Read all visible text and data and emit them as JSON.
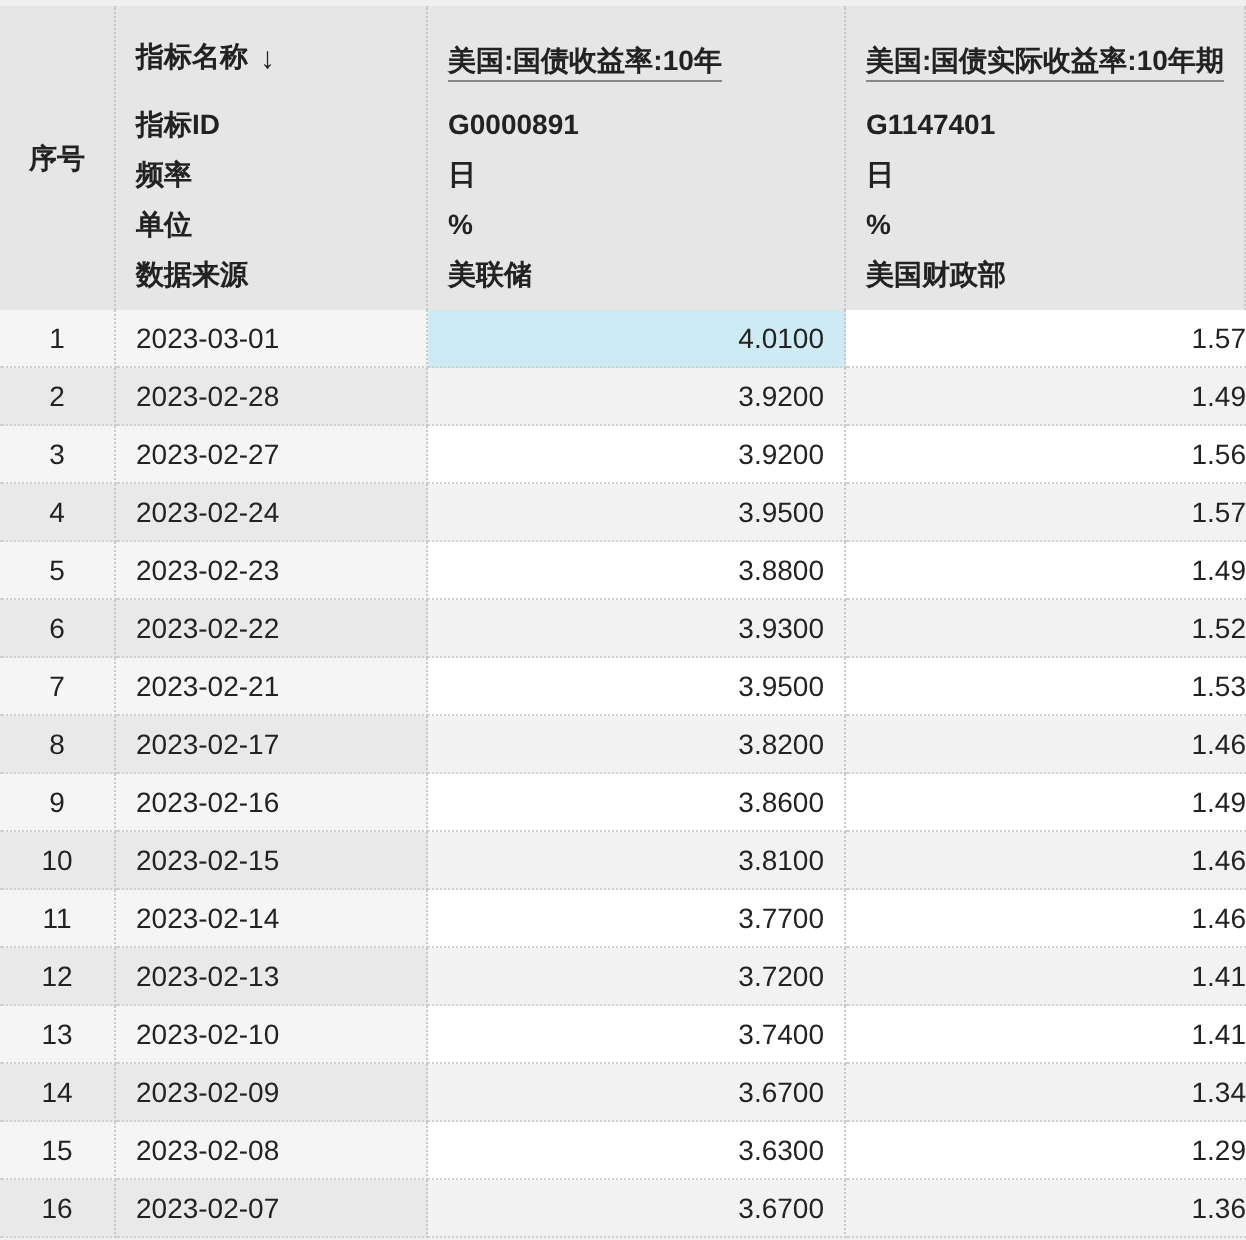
{
  "header": {
    "index_label": "序号",
    "name_label": "指标名称",
    "sort_mark": "↓",
    "field_labels": [
      "指标ID",
      "频率",
      "单位",
      "数据来源"
    ],
    "series": [
      {
        "name": "美国:国债收益率:10年",
        "fields": [
          "G0000891",
          "日",
          "%",
          "美联储"
        ]
      },
      {
        "name": "美国:国债实际收益率:10年期",
        "fields": [
          "G1147401",
          "日",
          "%",
          "美国财政部"
        ]
      }
    ]
  },
  "rows": [
    {
      "index": "1",
      "date": "2023-03-01",
      "values": [
        {
          "text": "4.0100",
          "selected": true
        },
        {
          "text": "1.57",
          "selected": false
        }
      ]
    },
    {
      "index": "2",
      "date": "2023-02-28",
      "values": [
        {
          "text": "3.9200",
          "selected": false
        },
        {
          "text": "1.49",
          "selected": false
        }
      ]
    },
    {
      "index": "3",
      "date": "2023-02-27",
      "values": [
        {
          "text": "3.9200",
          "selected": false
        },
        {
          "text": "1.56",
          "selected": false
        }
      ]
    },
    {
      "index": "4",
      "date": "2023-02-24",
      "values": [
        {
          "text": "3.9500",
          "selected": false
        },
        {
          "text": "1.57",
          "selected": false
        }
      ]
    },
    {
      "index": "5",
      "date": "2023-02-23",
      "values": [
        {
          "text": "3.8800",
          "selected": false
        },
        {
          "text": "1.49",
          "selected": false
        }
      ]
    },
    {
      "index": "6",
      "date": "2023-02-22",
      "values": [
        {
          "text": "3.9300",
          "selected": false
        },
        {
          "text": "1.52",
          "selected": false
        }
      ]
    },
    {
      "index": "7",
      "date": "2023-02-21",
      "values": [
        {
          "text": "3.9500",
          "selected": false
        },
        {
          "text": "1.53",
          "selected": false
        }
      ]
    },
    {
      "index": "8",
      "date": "2023-02-17",
      "values": [
        {
          "text": "3.8200",
          "selected": false
        },
        {
          "text": "1.46",
          "selected": false
        }
      ]
    },
    {
      "index": "9",
      "date": "2023-02-16",
      "values": [
        {
          "text": "3.8600",
          "selected": false
        },
        {
          "text": "1.49",
          "selected": false
        }
      ]
    },
    {
      "index": "10",
      "date": "2023-02-15",
      "values": [
        {
          "text": "3.8100",
          "selected": false
        },
        {
          "text": "1.46",
          "selected": false
        }
      ]
    },
    {
      "index": "11",
      "date": "2023-02-14",
      "values": [
        {
          "text": "3.7700",
          "selected": false
        },
        {
          "text": "1.46",
          "selected": false
        }
      ]
    },
    {
      "index": "12",
      "date": "2023-02-13",
      "values": [
        {
          "text": "3.7200",
          "selected": false
        },
        {
          "text": "1.41",
          "selected": false
        }
      ]
    },
    {
      "index": "13",
      "date": "2023-02-10",
      "values": [
        {
          "text": "3.7400",
          "selected": false
        },
        {
          "text": "1.41",
          "selected": false
        }
      ]
    },
    {
      "index": "14",
      "date": "2023-02-09",
      "values": [
        {
          "text": "3.6700",
          "selected": false
        },
        {
          "text": "1.34",
          "selected": false
        }
      ]
    },
    {
      "index": "15",
      "date": "2023-02-08",
      "values": [
        {
          "text": "3.6300",
          "selected": false
        },
        {
          "text": "1.29",
          "selected": false
        }
      ]
    },
    {
      "index": "16",
      "date": "2023-02-07",
      "values": [
        {
          "text": "3.6700",
          "selected": false
        },
        {
          "text": "1.36",
          "selected": false
        }
      ]
    }
  ]
}
